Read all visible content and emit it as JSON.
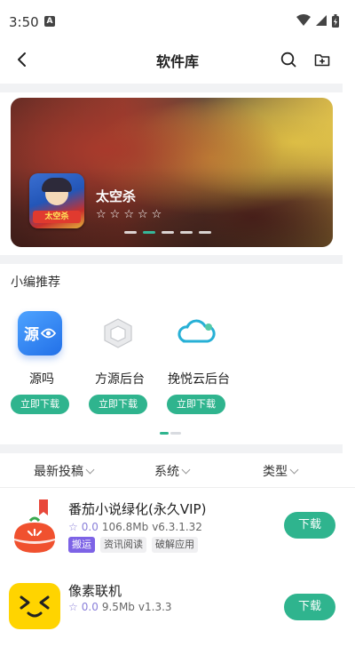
{
  "status_bar": {
    "time": "3:50"
  },
  "header": {
    "title": "软件库"
  },
  "banner": {
    "game_title": "太空杀",
    "game_icon_text": "太空杀",
    "rating_stars_filled": 0,
    "rating_stars_total": 5,
    "slides": 5,
    "active_slide": 2
  },
  "recommend": {
    "title": "小编推荐",
    "items": [
      {
        "name": "源吗",
        "button": "立即下载",
        "icon": "yuan-app-icon"
      },
      {
        "name": "方源后台",
        "button": "立即下载",
        "icon": "cube-app-icon"
      },
      {
        "name": "挽悦云后台",
        "button": "立即下载",
        "icon": "cloud-app-icon"
      }
    ]
  },
  "filters": [
    {
      "label": "最新投稿"
    },
    {
      "label": "系统"
    },
    {
      "label": "类型"
    }
  ],
  "apps": [
    {
      "title": "番茄小说绿化(永久VIP)",
      "rating": "0.0",
      "size": "106.8Mb",
      "version": "v6.3.1.32",
      "tags": [
        "搬运",
        "资讯阅读",
        "破解应用"
      ],
      "button": "下载",
      "bookmarked": true
    },
    {
      "title": "像素联机",
      "rating": "0.0",
      "size": "9.5Mb",
      "version": "v1.3.3",
      "tags": [],
      "button": "下载",
      "bookmarked": false
    }
  ],
  "colors": {
    "accent": "#2fb48e",
    "tag_purple": "#7d63e6",
    "bookmark": "#e8483b"
  }
}
